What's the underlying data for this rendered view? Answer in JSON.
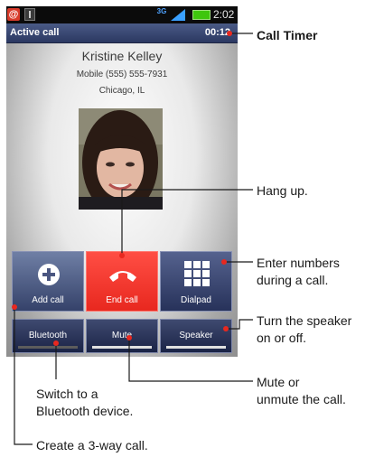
{
  "status_bar": {
    "time": "2:02",
    "network": "3G",
    "icons": [
      "gmail-icon",
      "usb-icon",
      "3g-icon",
      "signal-icon",
      "battery-icon"
    ]
  },
  "call": {
    "status": "Active call",
    "timer": "00:12",
    "caller_name": "Kristine Kelley",
    "caller_number": "Mobile (555) 555-7931",
    "caller_location": "Chicago, IL"
  },
  "buttons": {
    "add_call": "Add call",
    "end_call": "End call",
    "dialpad": "Dialpad",
    "bluetooth": "Bluetooth",
    "mute": "Mute",
    "speaker": "Speaker"
  },
  "annotations": {
    "call_timer": "Call Timer",
    "hang_up": "Hang up.",
    "dialpad_1": "Enter numbers",
    "dialpad_2": "during a call.",
    "speaker_1": "Turn the speaker",
    "speaker_2": "on or off.",
    "mute_1": "Mute or",
    "mute_2": "unmute the call.",
    "bluetooth_1": "Switch to a",
    "bluetooth_2": "Bluetooth device.",
    "add_call": "Create a 3-way call."
  },
  "colors": {
    "end_call": "#ff3b30",
    "button_blue": "#35426a",
    "callbar": "#3a4878",
    "leader_line": "#e8281f"
  }
}
